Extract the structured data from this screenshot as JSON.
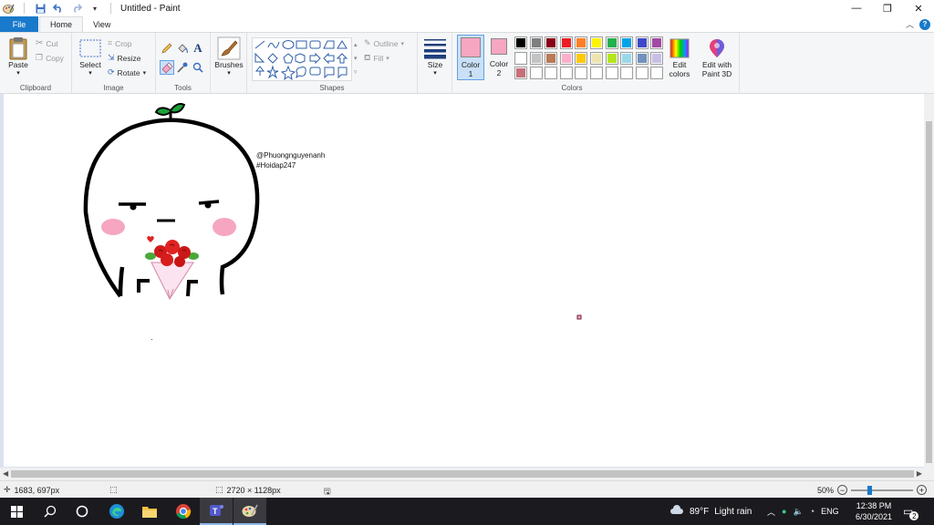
{
  "window": {
    "title": "Untitled - Paint",
    "controls": {
      "minimize": "—",
      "restore": "❐",
      "close": "✕"
    }
  },
  "tabs": {
    "file": "File",
    "home": "Home",
    "view": "View"
  },
  "ribbon": {
    "clipboard": {
      "label": "Clipboard",
      "paste": "Paste",
      "cut": "Cut",
      "copy": "Copy"
    },
    "image": {
      "label": "Image",
      "select": "Select",
      "crop": "Crop",
      "resize": "Resize",
      "rotate": "Rotate"
    },
    "tools": {
      "label": "Tools"
    },
    "brushes": {
      "label": "Brushes"
    },
    "shapes": {
      "label": "Shapes",
      "outline": "Outline",
      "fill": "Fill"
    },
    "size": {
      "label": "Size"
    },
    "colors": {
      "label": "Colors",
      "color1": "Color\n1",
      "color1_line1": "Color",
      "color1_line2": "1",
      "color2_line1": "Color",
      "color2_line2": "2",
      "color1_value": "#f6a6c1",
      "color2_value": "#f6a6c1",
      "edit_colors_line1": "Edit",
      "edit_colors_line2": "colors",
      "paint3d_line1": "Edit with",
      "paint3d_line2": "Paint 3D",
      "palette_row1": [
        "#000000",
        "#7f7f7f",
        "#880015",
        "#ed1c24",
        "#ff7f27",
        "#fff200",
        "#22b14c",
        "#00a2e8",
        "#3f48cc",
        "#a349a4"
      ],
      "palette_row2": [
        "#ffffff",
        "#c3c3c3",
        "#b97a57",
        "#ffaec9",
        "#ffc90e",
        "#efe4b0",
        "#b5e61d",
        "#99d9ea",
        "#7092be",
        "#c8bfe7"
      ],
      "palette_row3": [
        "#c87079",
        "",
        "",
        "",
        "",
        "",
        "",
        "",
        "",
        ""
      ]
    }
  },
  "canvas": {
    "signature_line1": "@Phuongnguyenanh",
    "signature_line2": "#Hoidap247"
  },
  "status": {
    "cursor_pos": "1683, 697px",
    "image_size": "2720 × 1128px",
    "zoom": "50%"
  },
  "taskbar": {
    "weather_temp": "89°F",
    "weather_text": "Light rain",
    "language": "ENG",
    "time": "12:38 PM",
    "date": "6/30/2021",
    "notifications": "2"
  }
}
